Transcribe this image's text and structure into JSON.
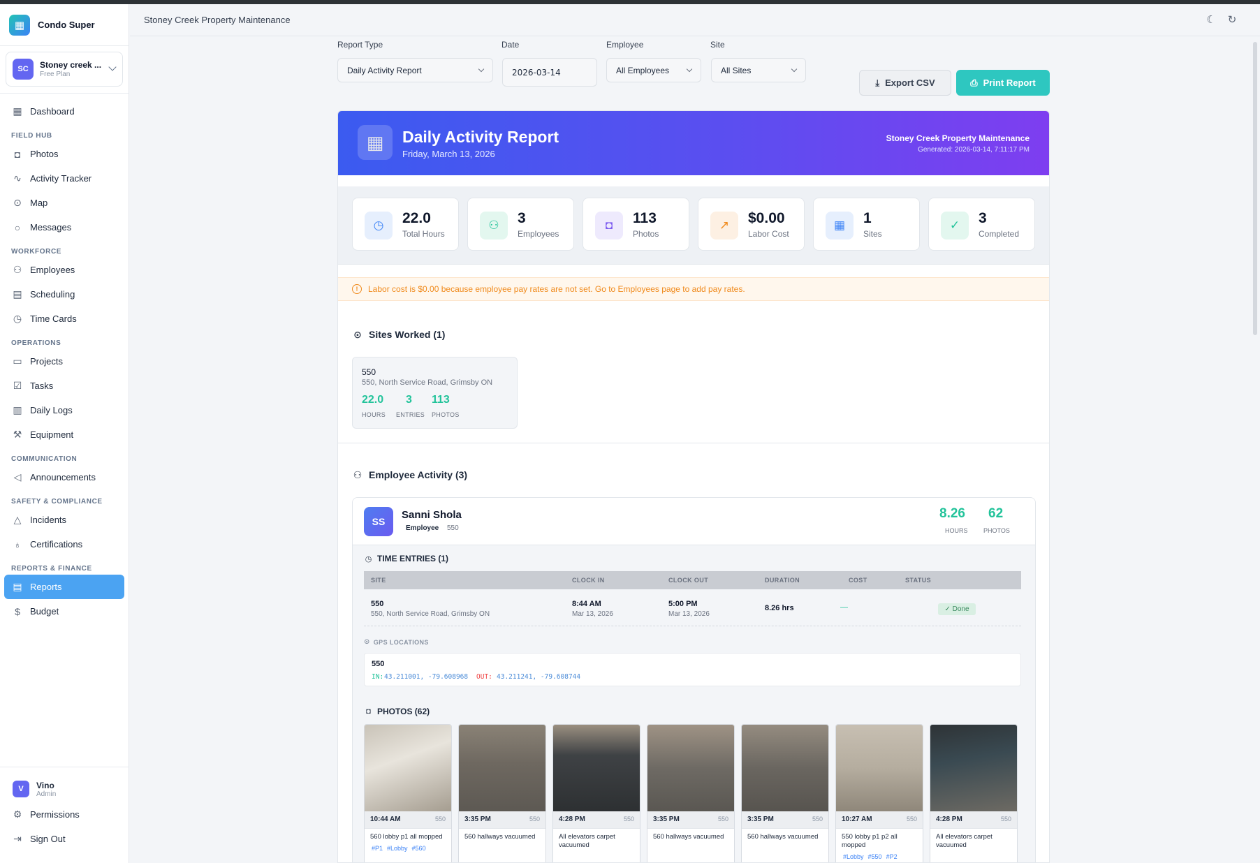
{
  "app": {
    "name": "Condo Super"
  },
  "org": {
    "name": "Stoney creek ...",
    "plan": "Free Plan",
    "initials": "SC"
  },
  "nav": {
    "dashboard": "Dashboard",
    "sec_field": "FIELD HUB",
    "photos": "Photos",
    "activity": "Activity Tracker",
    "map": "Map",
    "messages": "Messages",
    "sec_workforce": "WORKFORCE",
    "employees": "Employees",
    "scheduling": "Scheduling",
    "timecards": "Time Cards",
    "sec_ops": "OPERATIONS",
    "projects": "Projects",
    "tasks": "Tasks",
    "dailylogs": "Daily Logs",
    "equipment": "Equipment",
    "sec_comm": "COMMUNICATION",
    "announcements": "Announcements",
    "sec_safety": "SAFETY & COMPLIANCE",
    "incidents": "Incidents",
    "certifications": "Certifications",
    "sec_reports": "REPORTS & FINANCE",
    "reports": "Reports",
    "budget": "Budget"
  },
  "user": {
    "initial": "V",
    "name": "Vino",
    "role": "Admin",
    "permissions": "Permissions",
    "signout": "Sign Out"
  },
  "header": {
    "title": "Stoney Creek Property Maintenance"
  },
  "filters": {
    "report_type_label": "Report Type",
    "report_type_value": "Daily Activity Report",
    "date_label": "Date",
    "date_value": "2026-03-14",
    "employee_label": "Employee",
    "employee_value": "All Employees",
    "site_label": "Site",
    "site_value": "All Sites"
  },
  "actions": {
    "export": "Export CSV",
    "print": "Print Report"
  },
  "report": {
    "title": "Daily Activity Report",
    "date": "Friday, March 13, 2026",
    "org": "Stoney Creek Property Maintenance",
    "generated": "Generated: 2026-03-14, 7:11:17 PM"
  },
  "stats": [
    {
      "value": "22.0",
      "label": "Total Hours",
      "icon": "clock-icon",
      "color": "#3b82f6",
      "bg": "#e6effd"
    },
    {
      "value": "3",
      "label": "Employees",
      "icon": "users-icon",
      "color": "#22c39a",
      "bg": "#e3f7ef"
    },
    {
      "value": "113",
      "label": "Photos",
      "icon": "camera-icon",
      "color": "#7c5cf0",
      "bg": "#eeeafd"
    },
    {
      "value": "$0.00",
      "label": "Labor Cost",
      "icon": "trending-up-icon",
      "color": "#f08a1c",
      "bg": "#fdf0e3"
    },
    {
      "value": "1",
      "label": "Sites",
      "icon": "building-icon",
      "color": "#3b82f6",
      "bg": "#e6effd"
    },
    {
      "value": "3",
      "label": "Completed",
      "icon": "check-circle-icon",
      "color": "#22c39a",
      "bg": "#e3f7ef"
    }
  ],
  "warning": "Labor cost is $0.00 because employee pay rates are not set. Go to Employees page to add pay rates.",
  "sites_section": {
    "title": "Sites Worked (1)",
    "site": {
      "name": "550",
      "address": "550, North Service Road, Grimsby ON",
      "hours": "22.0",
      "hours_unit": "HOURS",
      "entries": "3",
      "entries_unit": "ENTRIES",
      "photos": "113",
      "photos_unit": "PHOTOS"
    }
  },
  "employee_section": {
    "title": "Employee Activity (3)",
    "employee": {
      "initials": "SS",
      "name": "Sanni Shola",
      "role": "Employee",
      "site": "550",
      "hours": "8.26",
      "hours_unit": "HOURS",
      "photos": "62",
      "photos_unit": "PHOTOS",
      "time_entries_title": "TIME ENTRIES (1)",
      "columns": [
        "SITE",
        "CLOCK IN",
        "CLOCK OUT",
        "DURATION",
        "COST",
        "STATUS"
      ],
      "entry": {
        "site": "550",
        "site_addr": "550, North Service Road, Grimsby ON",
        "clock_in": "8:44 AM",
        "clock_in_date": "Mar 13, 2026",
        "clock_out": "5:00 PM",
        "clock_out_date": "Mar 13, 2026",
        "duration": "8.26 hrs",
        "cost": "—",
        "status": "✓ Done"
      },
      "gps_title": "GPS LOCATIONS",
      "gps": {
        "site": "550",
        "in_label": "IN:",
        "in": "43.211001, -79.608968",
        "out_label": "OUT:",
        "out": "43.211241, -79.608744"
      },
      "photos_title": "PHOTOS (62)",
      "photo_list": [
        {
          "time": "10:44 AM",
          "site": "550",
          "caption": "560 lobby p1 all mopped",
          "tags": [
            "#P1",
            "#Lobby",
            "#560"
          ]
        },
        {
          "time": "3:35 PM",
          "site": "550",
          "caption": "560 hallways vacuumed",
          "tags": []
        },
        {
          "time": "4:28 PM",
          "site": "550",
          "caption": "All elevators carpet vacuumed",
          "tags": []
        },
        {
          "time": "3:35 PM",
          "site": "550",
          "caption": "560 hallways vacuumed",
          "tags": []
        },
        {
          "time": "3:35 PM",
          "site": "550",
          "caption": "560 hallways vacuumed",
          "tags": []
        },
        {
          "time": "10:27 AM",
          "site": "550",
          "caption": "550 lobby p1 p2 all mopped",
          "tags": [
            "#Lobby",
            "#550",
            "#P2"
          ]
        },
        {
          "time": "4:28 PM",
          "site": "550",
          "caption": "All elevators carpet vacuumed",
          "tags": []
        }
      ]
    }
  }
}
